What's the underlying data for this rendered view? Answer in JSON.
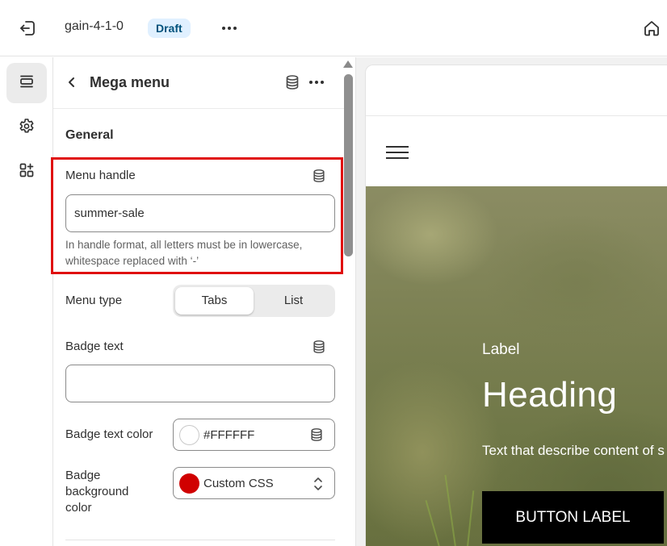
{
  "topbar": {
    "theme_name": "gain-4-1-0",
    "status_badge": "Draft",
    "icons": [
      "exit-icon",
      "more-horizontal-icon",
      "home-icon"
    ]
  },
  "rail": {
    "items": [
      {
        "name": "sections",
        "icon": "sections-icon",
        "active": true
      },
      {
        "name": "theme-settings",
        "icon": "gear-icon",
        "active": false
      },
      {
        "name": "apps",
        "icon": "apps-add-icon",
        "active": false
      }
    ]
  },
  "panel": {
    "title": "Mega menu",
    "section_title": "General",
    "menu_handle": {
      "label": "Menu handle",
      "value": "summer-sale",
      "help": "In handle format, all letters must be in lowercase, whitespace replaced with ‘-’"
    },
    "menu_type": {
      "label": "Menu type",
      "options": [
        "Tabs",
        "List"
      ],
      "selected": "Tabs"
    },
    "badge_text": {
      "label": "Badge text",
      "value": ""
    },
    "badge_text_color": {
      "label": "Badge text color",
      "value": "#FFFFFF",
      "swatch": "#ffffff"
    },
    "badge_background_color": {
      "label": "Badge background color",
      "label_lines": [
        "Badge",
        "background",
        "color"
      ],
      "value": "Custom CSS",
      "swatch": "#d00000"
    }
  },
  "preview": {
    "hero": {
      "label": "Label",
      "heading": "Heading",
      "description": "Text that describe content of s",
      "button_label": "BUTTON LABEL"
    }
  },
  "colors": {
    "accent_highlight": "#e01010",
    "badge_bg": "#e0f0ff",
    "badge_fg": "#00527c"
  }
}
